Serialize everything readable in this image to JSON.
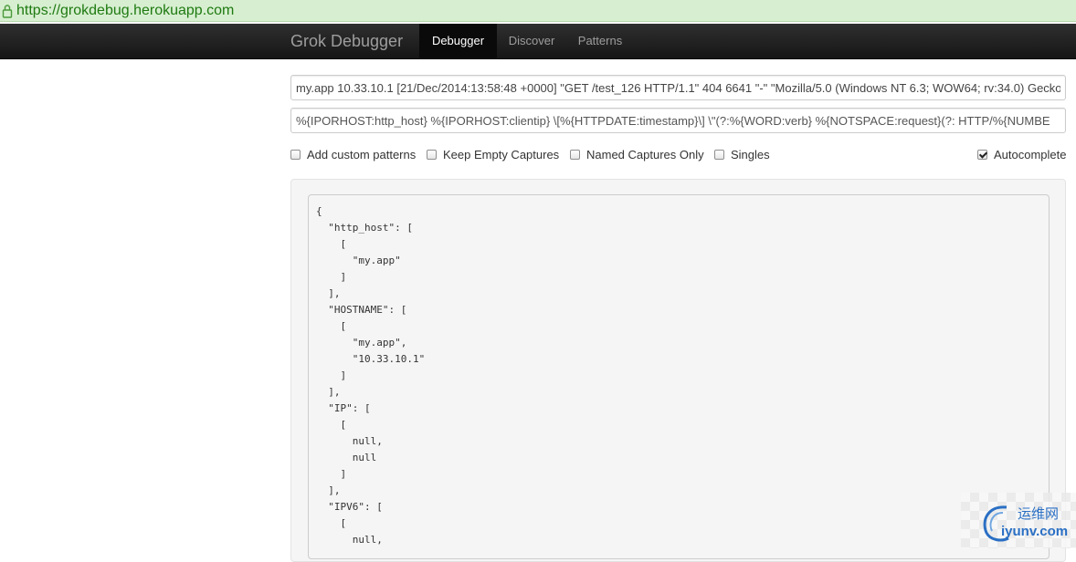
{
  "browser": {
    "url": "https://grokdebug.herokuapp.com"
  },
  "navbar": {
    "brand": "Grok Debugger",
    "items": [
      {
        "label": "Debugger",
        "active": true
      },
      {
        "label": "Discover",
        "active": false
      },
      {
        "label": "Patterns",
        "active": false
      }
    ]
  },
  "inputs": {
    "log_line": "my.app 10.33.10.1 [21/Dec/2014:13:58:48 +0000] \"GET /test_126 HTTP/1.1\" 404 6641 \"-\" \"Mozilla/5.0 (Windows NT 6.3; WOW64; rv:34.0) Gecko/",
    "pattern": "%{IPORHOST:http_host} %{IPORHOST:clientip} \\[%{HTTPDATE:timestamp}\\] \\\"(?:%{WORD:verb} %{NOTSPACE:request}(?: HTTP/%{NUMBE"
  },
  "options": [
    {
      "label": "Add custom patterns",
      "checked": false
    },
    {
      "label": "Keep Empty Captures",
      "checked": false
    },
    {
      "label": "Named Captures Only",
      "checked": false
    },
    {
      "label": "Singles",
      "checked": false
    },
    {
      "label": "Autocomplete",
      "checked": true
    }
  ],
  "output_lines": [
    "{",
    "  \"http_host\": [",
    "    [",
    "      \"my.app\"",
    "    ]",
    "  ],",
    "  \"HOSTNAME\": [",
    "    [",
    "      \"my.app\",",
    "      \"10.33.10.1\"",
    "    ]",
    "  ],",
    "  \"IP\": [",
    "    [",
    "      null,",
    "      null",
    "    ]",
    "  ],",
    "  \"IPV6\": [",
    "    [",
    "      null,"
  ],
  "watermark": {
    "cn": "运维网",
    "en": "iyunv.com"
  },
  "colors": {
    "urlbar_bg": "#d7efd0",
    "url_text": "#1f7a12",
    "navbar_bg": "#222222",
    "nav_active_bg": "#0a0a0a",
    "watermark": "#2a6fc4"
  }
}
